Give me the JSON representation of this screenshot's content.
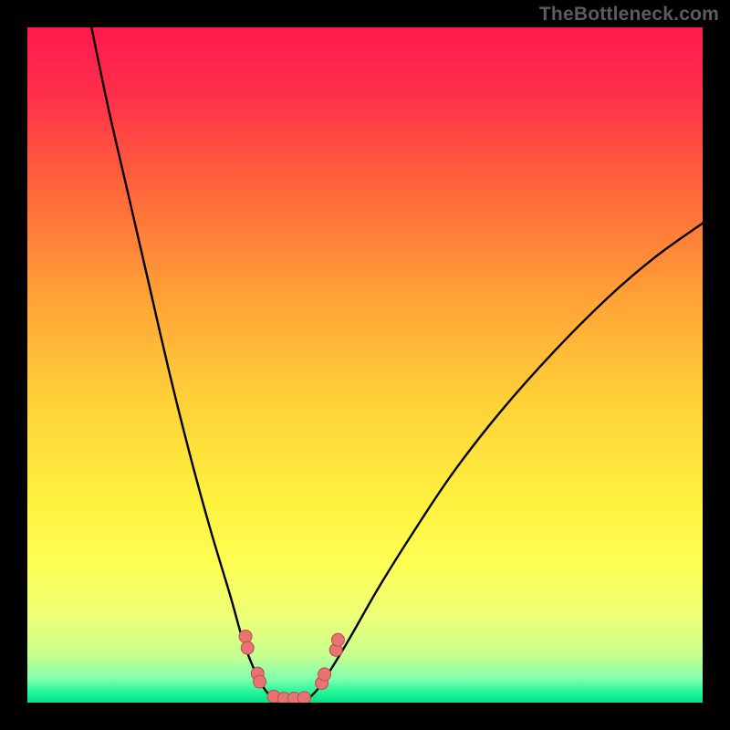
{
  "watermark": "TheBottleneck.com",
  "chart_data": {
    "type": "line",
    "title": "",
    "xlabel": "",
    "ylabel": "",
    "xlim": [
      0,
      100
    ],
    "ylim": [
      0,
      100
    ],
    "gradient_stops": [
      {
        "offset": 0.0,
        "color": "#ff1a4d"
      },
      {
        "offset": 0.1,
        "color": "#ff2f4a"
      },
      {
        "offset": 0.25,
        "color": "#ff6a3a"
      },
      {
        "offset": 0.4,
        "color": "#ffa236"
      },
      {
        "offset": 0.55,
        "color": "#ffd038"
      },
      {
        "offset": 0.7,
        "color": "#fff13e"
      },
      {
        "offset": 0.8,
        "color": "#fdff55"
      },
      {
        "offset": 0.88,
        "color": "#eaff7a"
      },
      {
        "offset": 0.93,
        "color": "#c7ff8e"
      },
      {
        "offset": 0.965,
        "color": "#7fffb0"
      },
      {
        "offset": 0.985,
        "color": "#22f59a"
      },
      {
        "offset": 1.0,
        "color": "#05e086"
      }
    ],
    "series": [
      {
        "name": "bottleneck-curve-left",
        "x": [
          9.5,
          12,
          15,
          18,
          21,
          24,
          27,
          30,
          32,
          34,
          35.5,
          36.8
        ],
        "y": [
          100,
          88,
          75,
          62,
          49,
          37,
          26,
          16,
          9,
          4,
          1.5,
          0.5
        ]
      },
      {
        "name": "bottleneck-curve-right",
        "x": [
          41.5,
          43,
          45,
          48,
          52,
          57,
          63,
          70,
          78,
          86,
          93,
          100
        ],
        "y": [
          0.5,
          2,
          5,
          10,
          17,
          25,
          34,
          43,
          52,
          60,
          66,
          71
        ]
      }
    ],
    "min_zone": {
      "x_start": 32,
      "x_end": 46,
      "y_top": 11
    },
    "markers": [
      {
        "x": 32.3,
        "y": 9.8
      },
      {
        "x": 32.6,
        "y": 8.1
      },
      {
        "x": 34.1,
        "y": 4.3
      },
      {
        "x": 34.4,
        "y": 3.1
      },
      {
        "x": 36.5,
        "y": 0.9
      },
      {
        "x": 38.0,
        "y": 0.6
      },
      {
        "x": 39.5,
        "y": 0.6
      },
      {
        "x": 41.0,
        "y": 0.7
      },
      {
        "x": 43.6,
        "y": 2.9
      },
      {
        "x": 44.0,
        "y": 4.2
      },
      {
        "x": 45.7,
        "y": 7.8
      },
      {
        "x": 46.0,
        "y": 9.3
      }
    ],
    "curve_color": "#000000",
    "marker_color": "#e97373",
    "marker_stroke": "#b84f4f"
  }
}
